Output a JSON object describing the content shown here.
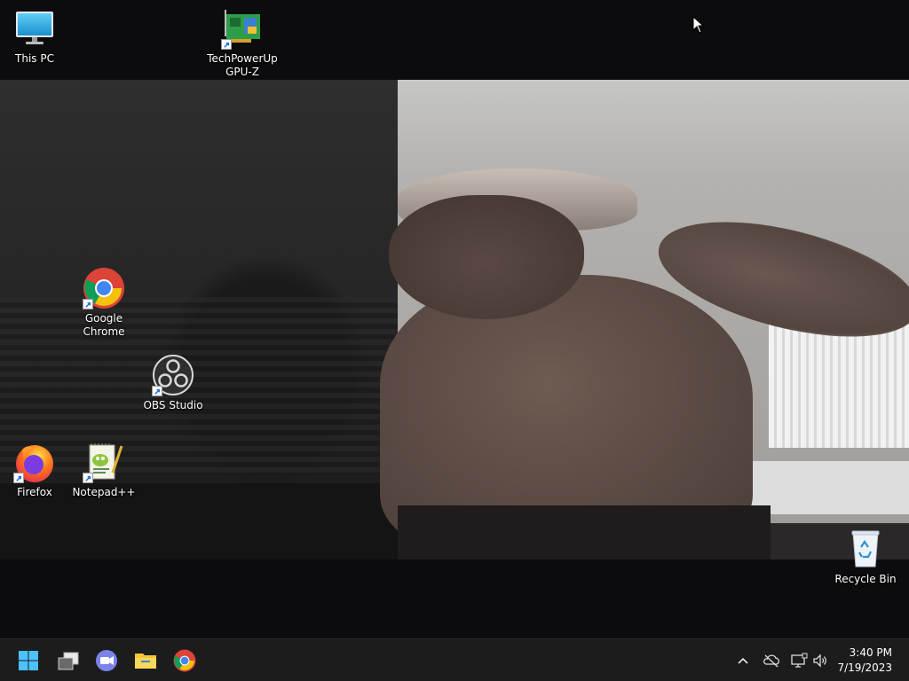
{
  "desktop": {
    "icons": [
      {
        "id": "this-pc",
        "label": "This PC"
      },
      {
        "id": "gpuz",
        "label": "TechPowerUp\nGPU-Z"
      },
      {
        "id": "chrome",
        "label": "Google\nChrome"
      },
      {
        "id": "obs",
        "label": "OBS Studio"
      },
      {
        "id": "firefox",
        "label": "Firefox"
      },
      {
        "id": "notepadpp",
        "label": "Notepad++"
      },
      {
        "id": "recycle-bin",
        "label": "Recycle Bin"
      }
    ]
  },
  "taskbar": {
    "buttons": [
      {
        "icon": "windows-start-icon"
      },
      {
        "icon": "task-view-icon"
      },
      {
        "icon": "teams-chat-icon"
      },
      {
        "icon": "file-explorer-icon"
      },
      {
        "icon": "chrome-icon"
      }
    ],
    "tray": [
      {
        "icon": "chevron-up-icon"
      },
      {
        "icon": "onedrive-icon"
      },
      {
        "icon": "network-icon"
      },
      {
        "icon": "volume-icon"
      }
    ],
    "clock": {
      "time": "3:40 PM",
      "date": "7/19/2023"
    }
  }
}
